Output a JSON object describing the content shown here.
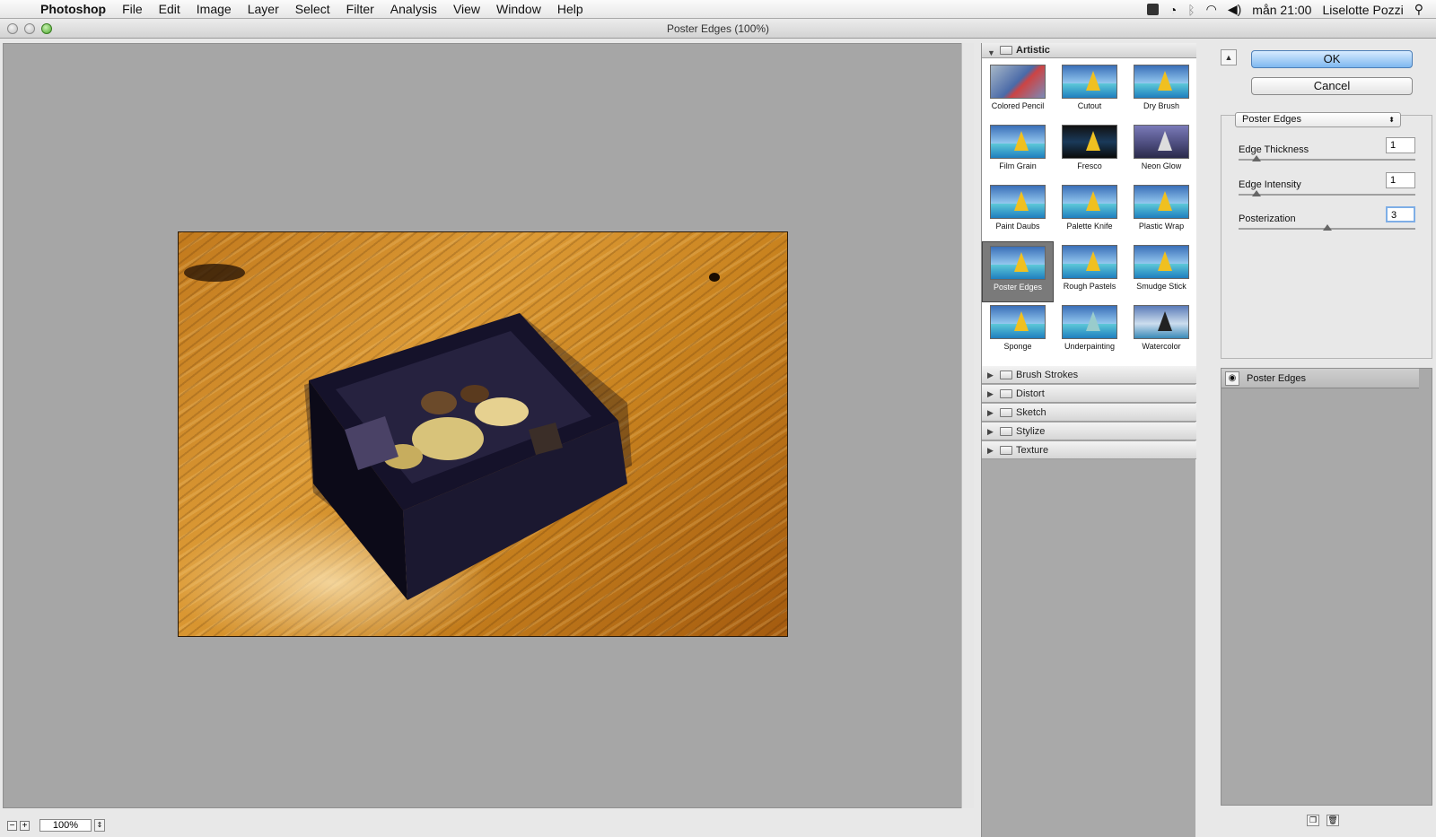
{
  "menubar": {
    "app": "Photoshop",
    "menus": [
      "File",
      "Edit",
      "Image",
      "Layer",
      "Select",
      "Filter",
      "Analysis",
      "View",
      "Window",
      "Help"
    ],
    "clock": "mån 21:00",
    "user": "Liselotte Pozzi"
  },
  "window": {
    "title": "Poster Edges (100%)"
  },
  "preview": {
    "zoom": "100%"
  },
  "filters": {
    "open_category": "Artistic",
    "thumbs": [
      "Colored Pencil",
      "Cutout",
      "Dry Brush",
      "Film Grain",
      "Fresco",
      "Neon Glow",
      "Paint Daubs",
      "Palette Knife",
      "Plastic Wrap",
      "Poster Edges",
      "Rough Pastels",
      "Smudge Stick",
      "Sponge",
      "Underpainting",
      "Watercolor"
    ],
    "selected": "Poster Edges",
    "categories": [
      "Brush Strokes",
      "Distort",
      "Sketch",
      "Stylize",
      "Texture"
    ]
  },
  "actions": {
    "ok": "OK",
    "cancel": "Cancel"
  },
  "settings": {
    "filter": "Poster Edges",
    "params": [
      {
        "name": "Edge Thickness",
        "value": "1",
        "fraction": 0.1
      },
      {
        "name": "Edge Intensity",
        "value": "1",
        "fraction": 0.1
      },
      {
        "name": "Posterization",
        "value": "3",
        "fraction": 0.5
      }
    ]
  },
  "layers": {
    "item": "Poster Edges"
  }
}
